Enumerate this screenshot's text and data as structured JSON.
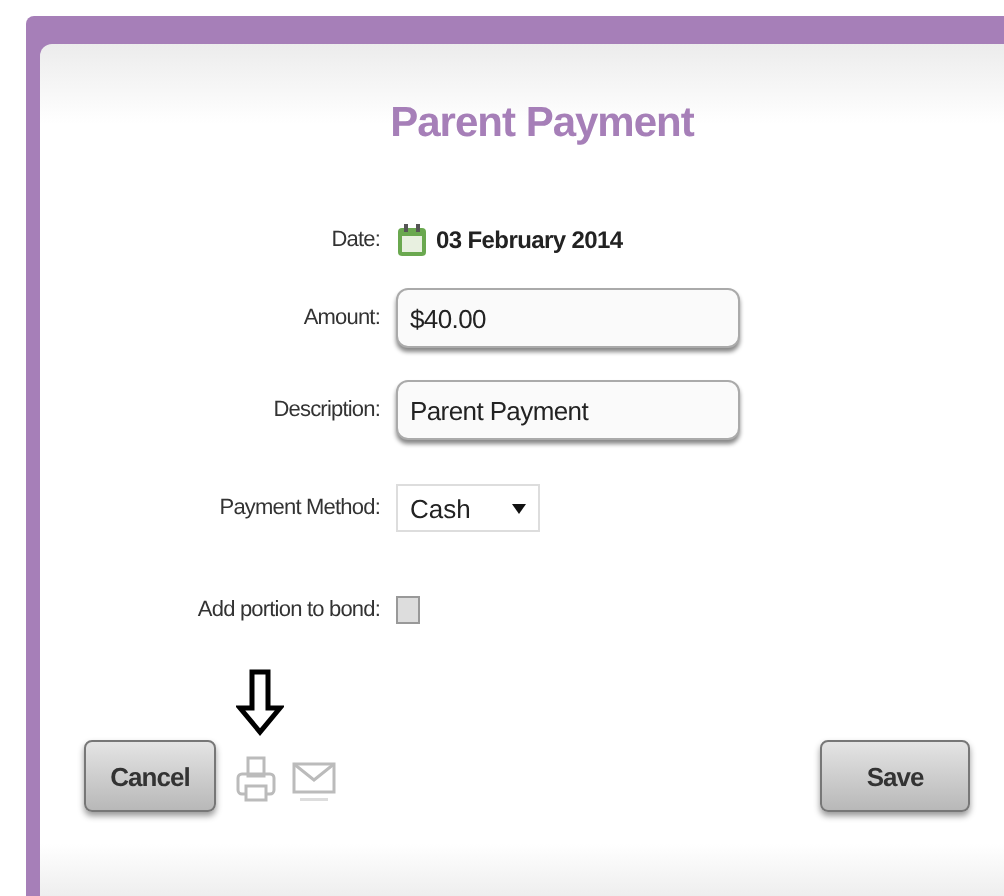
{
  "dialog": {
    "title": "Parent Payment"
  },
  "fields": [
    {
      "kind": "date",
      "label": "Date:",
      "value": "03 February 2014"
    },
    {
      "kind": "text",
      "label": "Amount:",
      "value": "$40.00"
    },
    {
      "kind": "text",
      "label": "Description:",
      "value": "Parent Payment"
    },
    {
      "kind": "select",
      "label": "Payment Method:",
      "value": "Cash"
    },
    {
      "kind": "checkbox",
      "label": "Add portion to bond:",
      "checked": false
    }
  ],
  "buttons": {
    "cancel": "Cancel",
    "save": "Save"
  }
}
